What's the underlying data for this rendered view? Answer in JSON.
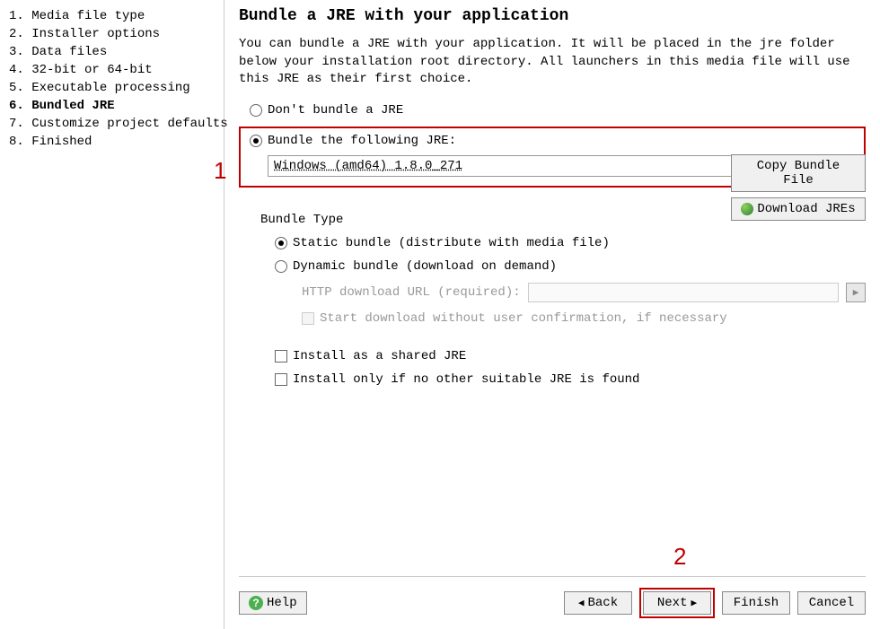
{
  "sidebar": {
    "items": [
      {
        "num": "1.",
        "label": "Media file type"
      },
      {
        "num": "2.",
        "label": "Installer options"
      },
      {
        "num": "3.",
        "label": "Data files"
      },
      {
        "num": "4.",
        "label": "32-bit or 64-bit"
      },
      {
        "num": "5.",
        "label": "Executable processing"
      },
      {
        "num": "6.",
        "label": "Bundled JRE"
      },
      {
        "num": "7.",
        "label": "Customize project defaults"
      },
      {
        "num": "8.",
        "label": "Finished"
      }
    ],
    "active_index": 5
  },
  "main": {
    "title": "Bundle a JRE with your application",
    "description": "You can bundle a JRE with your application. It will be placed in the jre folder below your installation root directory. All launchers in this media file will use this JRE as their first choice.",
    "radio_no_bundle": "Don't bundle a JRE",
    "radio_bundle": "Bundle the following JRE:",
    "jre_selected": "Windows (amd64) 1.8.0_271",
    "copy_button": "Copy Bundle File",
    "download_button": "Download JREs",
    "bundle_type_label": "Bundle Type",
    "radio_static": "Static bundle (distribute with media file)",
    "radio_dynamic": "Dynamic bundle (download on demand)",
    "http_label": "HTTP download URL (required):",
    "start_download_label": "Start download without user confirmation, if necessary",
    "install_shared_label": "Install as a shared JRE",
    "install_only_label": "Install only if no other suitable JRE is found"
  },
  "footer": {
    "help": "Help",
    "back": "Back",
    "next": "Next",
    "finish": "Finish",
    "cancel": "Cancel"
  },
  "annotations": {
    "one": "1",
    "two": "2"
  }
}
